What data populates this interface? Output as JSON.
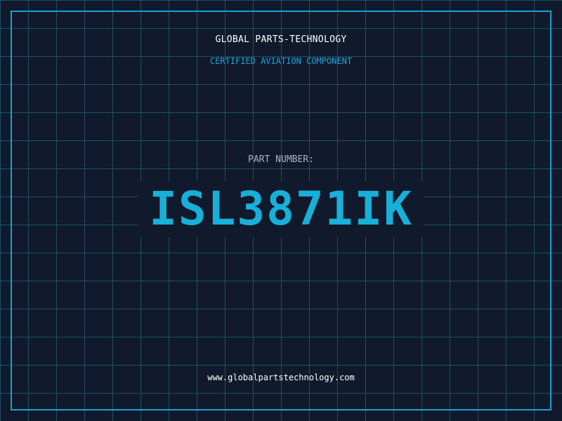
{
  "header": {
    "company_name": "GLOBAL PARTS-TECHNOLOGY",
    "subtitle": "CERTIFIED AVIATION COMPONENT"
  },
  "part": {
    "label": "PART NUMBER:",
    "number": "ISL3871IK"
  },
  "footer": {
    "url": "www.globalpartstechnology.com"
  },
  "colors": {
    "background": "#111a2c",
    "grid": "#26789a",
    "accent": "#1aa3cf",
    "part_number": "#17b0d8"
  }
}
